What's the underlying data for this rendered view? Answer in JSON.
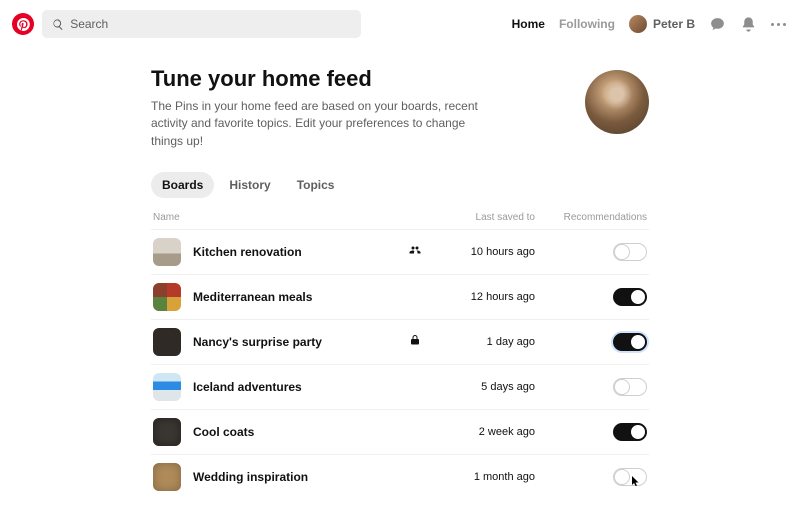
{
  "header": {
    "search_placeholder": "Search",
    "nav": {
      "home": "Home",
      "following": "Following"
    },
    "user_name": "Peter B"
  },
  "hero": {
    "title": "Tune your home feed",
    "description": "The Pins in your home feed are based on your boards, recent activity and favorite topics. Edit your preferences to change things up!"
  },
  "tabs": {
    "items": [
      {
        "label": "Boards",
        "active": true
      },
      {
        "label": "History",
        "active": false
      },
      {
        "label": "Topics",
        "active": false
      }
    ]
  },
  "table": {
    "columns": {
      "name": "Name",
      "last_saved": "Last saved to",
      "recommendations": "Recommendations"
    },
    "rows": [
      {
        "name": "Kitchen renovation",
        "meta": "shared",
        "last_saved": "10 hours ago",
        "recommendations_on": false,
        "thumb": "kitchen"
      },
      {
        "name": "Mediterranean meals",
        "meta": "",
        "last_saved": "12 hours ago",
        "recommendations_on": true,
        "thumb": "med"
      },
      {
        "name": "Nancy's surprise party",
        "meta": "secret",
        "last_saved": "1 day ago",
        "recommendations_on": true,
        "thumb": "party",
        "focus": true
      },
      {
        "name": "Iceland adventures",
        "meta": "",
        "last_saved": "5 days ago",
        "recommendations_on": false,
        "thumb": "iceland"
      },
      {
        "name": "Cool coats",
        "meta": "",
        "last_saved": "2 week ago",
        "recommendations_on": true,
        "thumb": "coats"
      },
      {
        "name": "Wedding inspiration",
        "meta": "",
        "last_saved": "1 month ago",
        "recommendations_on": false,
        "thumb": "wedding",
        "cursor": true
      }
    ]
  }
}
